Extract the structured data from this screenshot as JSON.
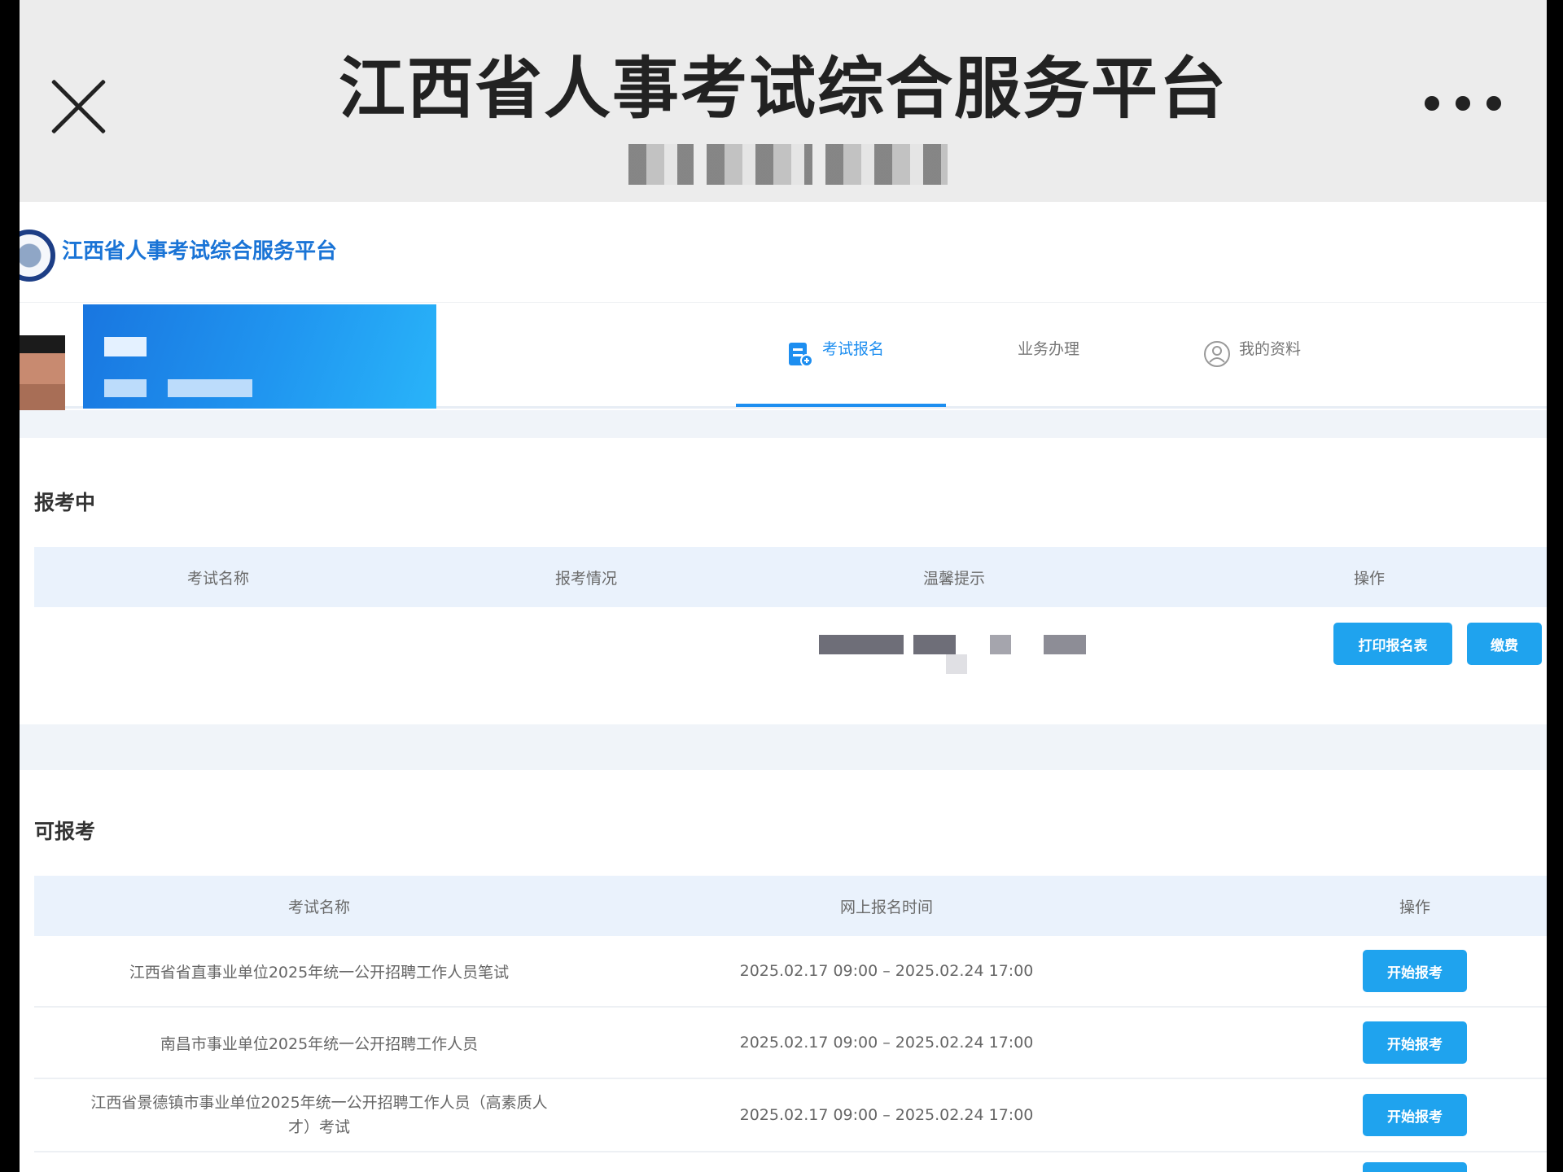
{
  "window": {
    "title": "江西省人事考试综合服务平台",
    "close_icon": "close-icon",
    "more_icon": "more-horizontal-icon"
  },
  "site": {
    "name": "江西省人事考试综合服务平台",
    "logo_icon": "emblem-logo"
  },
  "nav": {
    "tabs": [
      {
        "label": "考试报名",
        "icon": "exam-registration-icon",
        "active": true
      },
      {
        "label": "业务办理",
        "active": false
      },
      {
        "label": "我的资料",
        "icon": "user-profile-icon",
        "active": false
      }
    ],
    "accent": "#1d8ef0"
  },
  "registering": {
    "title": "报考中",
    "columns": [
      "考试名称",
      "报考情况",
      "温馨提示",
      "操作"
    ],
    "row": {
      "print_button": "打印报名表",
      "pay_button": "缴费"
    }
  },
  "available": {
    "title": "可报考",
    "columns": [
      "考试名称",
      "网上报名时间",
      "操作"
    ],
    "rows": [
      {
        "name": "江西省省直事业单位2025年统一公开招聘工作人员笔试",
        "time": "2025.02.17 09:00 – 2025.02.24 17:00",
        "action": "开始报考"
      },
      {
        "name": "南昌市事业单位2025年统一公开招聘工作人员",
        "time": "2025.02.17 09:00 – 2025.02.24 17:00",
        "action": "开始报考"
      },
      {
        "name_line1": "江西省景德镇市事业单位2025年统一公开招聘工作人员（高素质人",
        "name_line2": "才）考试",
        "time": "2025.02.17 09:00 – 2025.02.24 17:00",
        "action": "开始报考"
      }
    ]
  },
  "colors": {
    "button": "#1fa3ee",
    "table_header": "#eaf2fc",
    "band": "#f0f4f9"
  }
}
